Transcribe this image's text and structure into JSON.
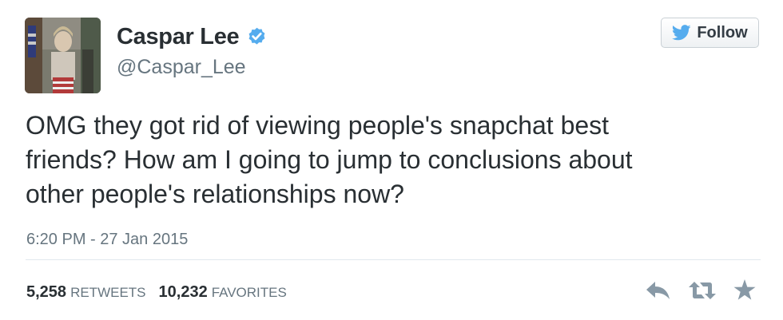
{
  "user": {
    "name": "Caspar Lee",
    "handle": "@Caspar_Lee",
    "verified": true
  },
  "follow_button": {
    "label": "Follow"
  },
  "tweet": {
    "text_lines": [
      "OMG they got rid of viewing people's snapchat best",
      "friends? How am I going to jump to conclusions about",
      "other people's relationships now?"
    ],
    "timestamp": "6:20 PM - 27 Jan 2015"
  },
  "stats": {
    "retweets_count": "5,258",
    "retweets_label": "RETWEETS",
    "favorites_count": "10,232",
    "favorites_label": "FAVORITES"
  },
  "actions": {
    "icons": [
      "reply-icon",
      "retweet-icon",
      "favorite-icon"
    ]
  },
  "colors": {
    "text": "#292f33",
    "secondary": "#66757f",
    "twitter_blue": "#55acee",
    "divider": "#e1e8ed",
    "icon_gray": "#8899a6"
  }
}
